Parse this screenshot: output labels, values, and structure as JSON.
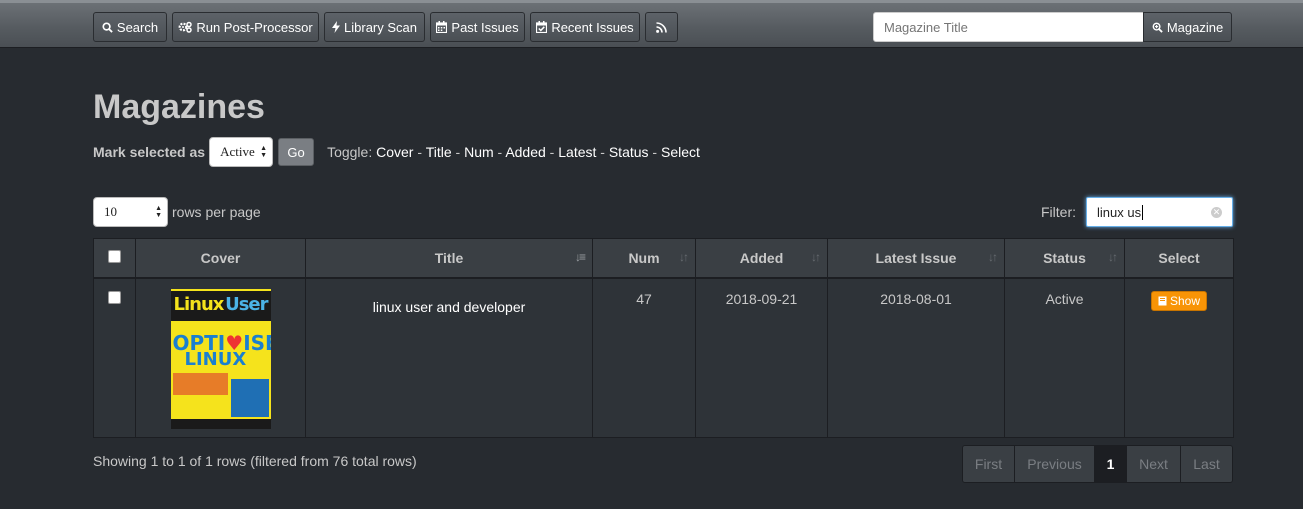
{
  "nav": {
    "buttons": [
      {
        "label": "Search",
        "icon": "search-icon"
      },
      {
        "label": "Run Post-Processor",
        "icon": "gears-icon"
      },
      {
        "label": "Library Scan",
        "icon": "bolt-icon"
      },
      {
        "label": "Past Issues",
        "icon": "calendar-icon"
      },
      {
        "label": "Recent Issues",
        "icon": "calendar-check-icon"
      },
      {
        "label": "",
        "icon": "rss-icon"
      }
    ],
    "search_placeholder": "Magazine Title",
    "search_button": "Magazine"
  },
  "page_title": "Magazines",
  "mark": {
    "label": "Mark selected as",
    "selected_value": "Active",
    "go_label": "Go"
  },
  "toggle": {
    "label": "Toggle:",
    "items": [
      "Cover",
      "Title",
      "Num",
      "Added",
      "Latest",
      "Status",
      "Select"
    ],
    "separator": " - "
  },
  "rows_per_page": {
    "value": "10",
    "label": "rows per page"
  },
  "filter": {
    "label": "Filter:",
    "value": "linux us"
  },
  "table": {
    "columns": [
      "",
      "Cover",
      "Title",
      "Num",
      "Added",
      "Latest Issue",
      "Status",
      "Select"
    ],
    "rows": [
      {
        "cover_text": {
          "mast_left": "Linux",
          "mast_right": "User",
          "headline_1": "OPTI",
          "headline_2": "ISE",
          "headline_3": "LINUX"
        },
        "title": "linux user and developer",
        "num": "47",
        "added": "2018-09-21",
        "latest": "2018-08-01",
        "status": "Active",
        "select_label": "Show"
      }
    ]
  },
  "footer": {
    "showing": "Showing 1 to 1 of 1 rows (filtered from 76 total rows)",
    "pager": [
      "First",
      "Previous",
      "1",
      "Next",
      "Last"
    ],
    "active_page": "1"
  },
  "colors": {
    "accent_orange": "#f89406",
    "background": "#272b30"
  }
}
